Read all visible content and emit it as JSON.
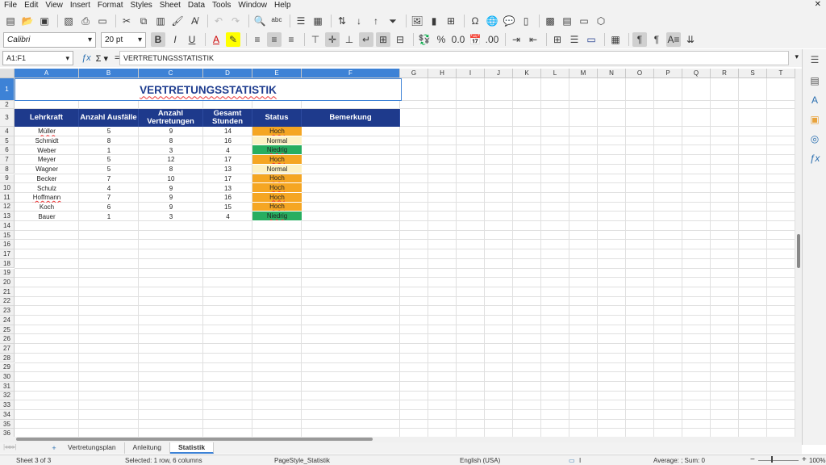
{
  "menu": [
    "File",
    "Edit",
    "View",
    "Insert",
    "Format",
    "Styles",
    "Sheet",
    "Data",
    "Tools",
    "Window",
    "Help"
  ],
  "font": {
    "name": "Calibri",
    "size": "20 pt"
  },
  "namebox": "A1:F1",
  "formula": "VERTRETUNGSSTATISTIK",
  "columns": [
    "A",
    "B",
    "C",
    "D",
    "E",
    "F",
    "G",
    "H",
    "I",
    "J",
    "K",
    "L",
    "M",
    "N",
    "O",
    "P",
    "Q",
    "R",
    "S",
    "T"
  ],
  "rows": [
    "1",
    "2",
    "3",
    "4",
    "5",
    "6",
    "7",
    "8",
    "9",
    "10",
    "11",
    "12",
    "13",
    "14",
    "15",
    "16",
    "17",
    "18",
    "19",
    "20",
    "21",
    "22",
    "23",
    "24",
    "25",
    "26",
    "27",
    "28",
    "29",
    "30",
    "31",
    "32",
    "33",
    "34",
    "35",
    "36",
    "37"
  ],
  "title": "VERTRETUNGSSTATISTIK",
  "headers": [
    "Lehrkraft",
    "Anzahl Ausfälle",
    "Anzahl Vertretungen",
    "Gesamt Stunden",
    "Status",
    "Bemerkung"
  ],
  "table": [
    {
      "name": "Müller",
      "ausfaelle": "5",
      "vertretungen": "9",
      "stunden": "14",
      "status": "Hoch",
      "color": "#f5a623"
    },
    {
      "name": "Schmidt",
      "ausfaelle": "8",
      "vertretungen": "8",
      "stunden": "16",
      "status": "Normal",
      "color": "#fdf2c4"
    },
    {
      "name": "Weber",
      "ausfaelle": "1",
      "vertretungen": "3",
      "stunden": "4",
      "status": "Niedrig",
      "color": "#27ae60"
    },
    {
      "name": "Meyer",
      "ausfaelle": "5",
      "vertretungen": "12",
      "stunden": "17",
      "status": "Hoch",
      "color": "#f5a623"
    },
    {
      "name": "Wagner",
      "ausfaelle": "5",
      "vertretungen": "8",
      "stunden": "13",
      "status": "Normal",
      "color": "#fdf2c4"
    },
    {
      "name": "Becker",
      "ausfaelle": "7",
      "vertretungen": "10",
      "stunden": "17",
      "status": "Hoch",
      "color": "#f5a623"
    },
    {
      "name": "Schulz",
      "ausfaelle": "4",
      "vertretungen": "9",
      "stunden": "13",
      "status": "Hoch",
      "color": "#f5a623"
    },
    {
      "name": "Hoffmann",
      "ausfaelle": "7",
      "vertretungen": "9",
      "stunden": "16",
      "status": "Hoch",
      "color": "#f5a623"
    },
    {
      "name": "Koch",
      "ausfaelle": "6",
      "vertretungen": "9",
      "stunden": "15",
      "status": "Hoch",
      "color": "#f5a623"
    },
    {
      "name": "Bauer",
      "ausfaelle": "1",
      "vertretungen": "3",
      "stunden": "4",
      "status": "Niedrig",
      "color": "#27ae60"
    }
  ],
  "tabs": [
    "Vertretungsplan",
    "Anleitung",
    "Statistik"
  ],
  "active_tab": "Statistik",
  "status": {
    "sheet": "Sheet 3 of 3",
    "selected": "Selected: 1 row, 6 columns",
    "pagestyle": "PageStyle_Statistik",
    "language": "English (USA)",
    "sum": "Average: ; Sum: 0",
    "zoom": "100%"
  }
}
